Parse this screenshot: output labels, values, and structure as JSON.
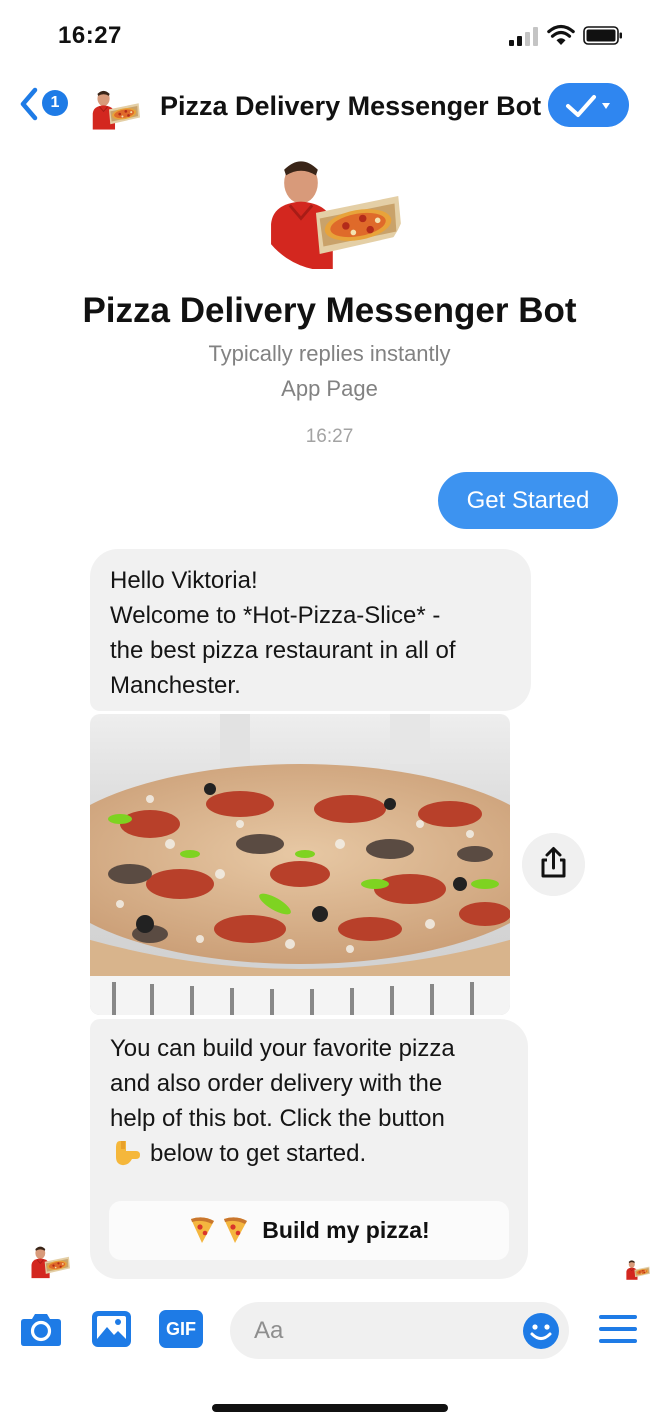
{
  "status_bar": {
    "time": "16:27"
  },
  "header": {
    "back_badge_count": "1",
    "title": "Pizza Delivery Messenger Bot",
    "icons": [
      "back-chevron-icon",
      "bot-avatar-icon",
      "checkmark-icon",
      "dropdown-caret-icon"
    ]
  },
  "profile": {
    "name": "Pizza Delivery Messenger Bot",
    "subtitle": "Typically replies instantly",
    "page_type": "App Page"
  },
  "conversation": {
    "timestamp": "16:27",
    "outgoing": {
      "text": "Get Started"
    },
    "message_1": {
      "lines": [
        "Hello Viktoria!",
        "Welcome to *Hot-Pizza-Slice* -",
        "the best pizza restaurant in all of",
        "Manchester."
      ]
    },
    "message_2": {
      "lines": [
        "You can build your favorite pizza",
        "and also order delivery with the",
        "help of this bot. Click the button",
        "below to get started."
      ],
      "button_label": "Build my pizza!"
    }
  },
  "composer": {
    "placeholder": "Aa",
    "gif_label": "GIF",
    "icons": [
      "camera-icon",
      "photo-icon",
      "gif-icon",
      "smiley-icon",
      "menu-icon"
    ]
  },
  "colors": {
    "messenger_blue": "#1e7be6",
    "outgoing_bubble": "#3d93f0",
    "incoming_bubble": "#f1f1f1",
    "secondary_text": "#828282"
  }
}
